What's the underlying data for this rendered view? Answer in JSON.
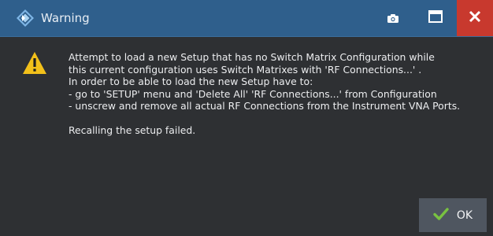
{
  "window": {
    "title": "Warning",
    "accent_color": "#2f5f8c",
    "close_color": "#c8392e"
  },
  "icons": {
    "app": "rohde-schwarz-logo-icon",
    "camera": "camera-icon",
    "maximize": "maximize-icon",
    "close": "close-icon",
    "warning": "warning-triangle-icon",
    "check": "checkmark-icon"
  },
  "message": {
    "lines": [
      "Attempt to load a new Setup that has no Switch Matrix Configuration while",
      "this current configuration uses Switch Matrixes with 'RF Connections...' .",
      "In order to be able to load the new Setup have to:",
      "- go to 'SETUP' menu and 'Delete All' 'RF Connections...' from Configuration",
      "- unscrew and remove all actual RF Connections from the Instrument VNA Ports.",
      "",
      "Recalling the setup failed."
    ]
  },
  "buttons": {
    "ok_label": "OK"
  }
}
